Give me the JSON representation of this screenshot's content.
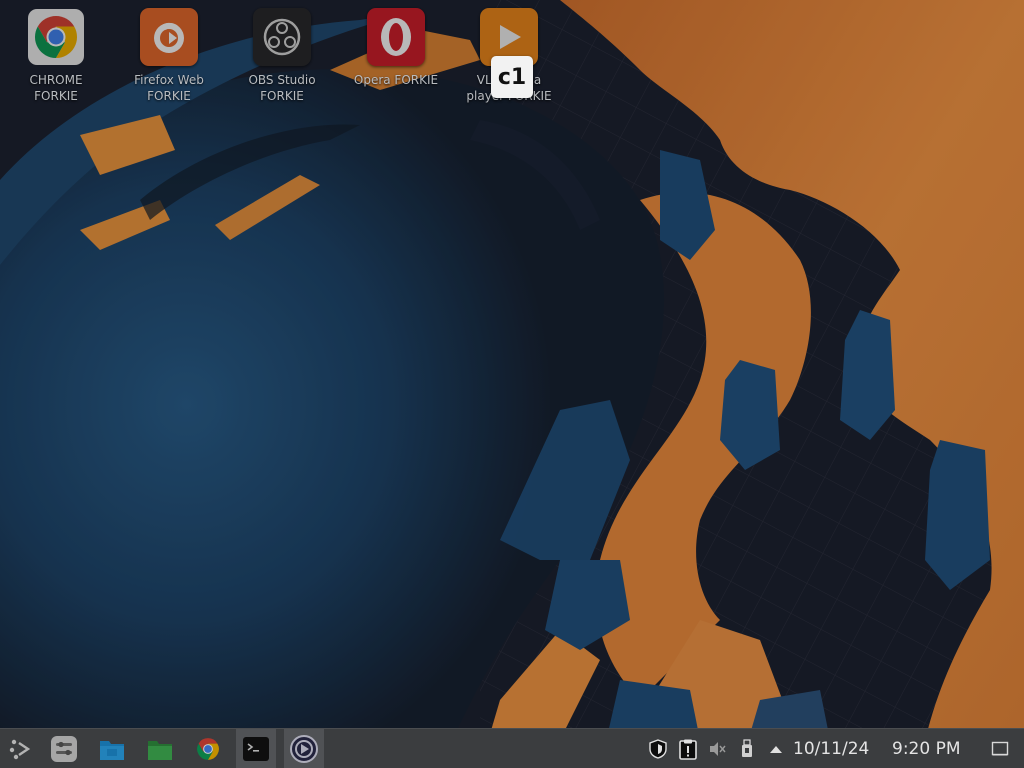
{
  "desktop": {
    "icons": [
      {
        "name": "chrome",
        "label": "CHROME\nFORKIE"
      },
      {
        "name": "firefox",
        "label": "Firefox Web\nFORKIE"
      },
      {
        "name": "obs",
        "label": "OBS Studio\nFORKIE"
      },
      {
        "name": "opera",
        "label": "Opera FORKIE"
      },
      {
        "name": "vlc",
        "label": "VLC media\nplayer FORKIE"
      }
    ],
    "overlay_badge": "c1"
  },
  "taskbar": {
    "launcher_icon": "application-launcher-icon",
    "pinned": [
      {
        "name": "system-settings-icon"
      },
      {
        "name": "file-manager-folder-icon"
      },
      {
        "name": "folder-icon"
      },
      {
        "name": "chrome-icon"
      },
      {
        "name": "terminal-icon",
        "active": true
      },
      {
        "name": "obs-studio-icon",
        "active": true
      }
    ],
    "tray": {
      "icons": [
        "shield-icon",
        "clipboard-icon",
        "volume-muted-icon",
        "usb-device-icon",
        "expand-tray-arrow-icon"
      ],
      "date": "10/11/24",
      "time": "9:20 PM",
      "show_desktop_icon": "show-desktop-icon"
    }
  },
  "colors": {
    "wallpaper_blue": "#1f4a72",
    "wallpaper_orange": "#e08a3e",
    "taskbar": "#3b3d3f",
    "label_text": "#b9bcc0"
  }
}
